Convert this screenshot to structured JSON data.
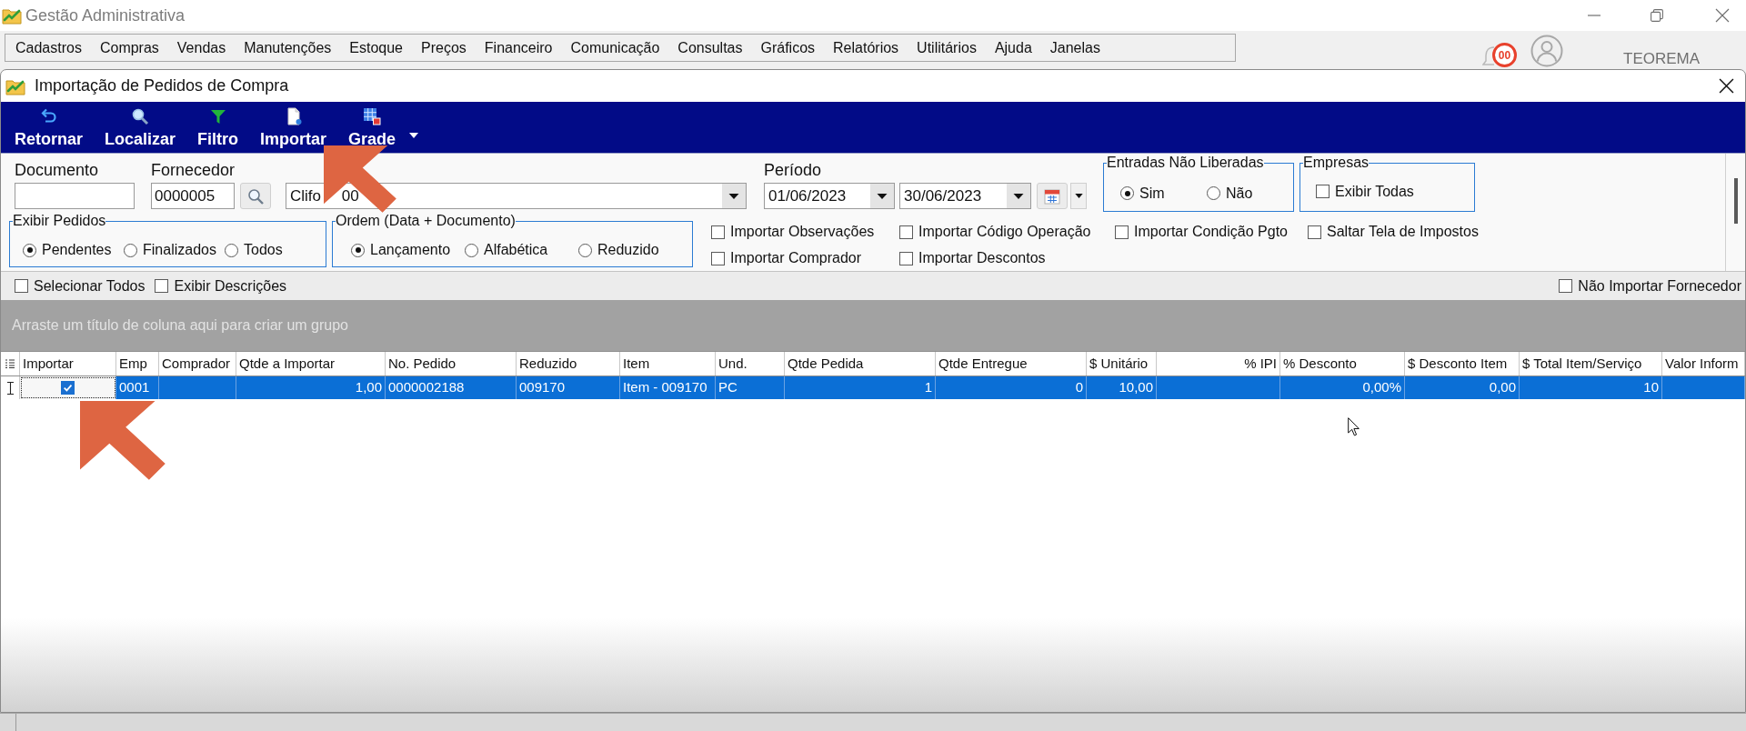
{
  "app": {
    "title": "Gestão Administrativa"
  },
  "menu": [
    "Cadastros",
    "Compras",
    "Vendas",
    "Manutenções",
    "Estoque",
    "Preços",
    "Financeiro",
    "Comunicação",
    "Consultas",
    "Gráficos",
    "Relatórios",
    "Utilitários",
    "Ajuda",
    "Janelas"
  ],
  "header_extras": {
    "notification_count": "00",
    "brand": "TEOREMA"
  },
  "window": {
    "title": "Importação de Pedidos de Compra"
  },
  "toolbar": [
    "Retornar",
    "Localizar",
    "Filtro",
    "Importar",
    "Grade"
  ],
  "filters": {
    "document": {
      "label": "Documento"
    },
    "supplier": {
      "label": "Fornecedor",
      "code": "0000005",
      "name_visible": [
        "Clifo",
        "00"
      ]
    },
    "period": {
      "label": "Período",
      "from": "01/06/2023",
      "to": "30/06/2023"
    },
    "unreleased_entries": {
      "title": "Entradas Não Liberadas",
      "options": [
        {
          "label": "Sim",
          "selected": true
        },
        {
          "label": "Não",
          "selected": false
        }
      ]
    },
    "companies": {
      "title": "Empresas",
      "show_all": {
        "label": "Exibir Todas",
        "checked": false
      }
    },
    "show_orders": {
      "title": "Exibir Pedidos",
      "options": [
        {
          "label": "Pendentes",
          "selected": true
        },
        {
          "label": "Finalizados",
          "selected": false
        },
        {
          "label": "Todos",
          "selected": false
        }
      ]
    },
    "order_by": {
      "title": "Ordem (Data + Documento)",
      "options": [
        {
          "label": "Lançamento",
          "selected": true
        },
        {
          "label": "Alfabética",
          "selected": false
        },
        {
          "label": "Reduzido",
          "selected": false
        }
      ]
    },
    "import_options": [
      [
        {
          "label": "Importar Observações",
          "checked": false
        },
        {
          "label": "Importar Comprador",
          "checked": false
        }
      ],
      [
        {
          "label": "Importar Código Operação",
          "checked": false
        },
        {
          "label": "Importar Descontos",
          "checked": false
        }
      ],
      [
        {
          "label": "Importar Condição Pgto",
          "checked": false
        }
      ],
      [
        {
          "label": "Saltar Tela de Impostos",
          "checked": false
        }
      ]
    ]
  },
  "grid_options": {
    "left": [
      {
        "label": "Selecionar Todos",
        "checked": false
      },
      {
        "label": "Exibir Descrições",
        "checked": false
      }
    ],
    "right": [
      {
        "label": "Não Importar Fornecedor",
        "checked": false
      }
    ]
  },
  "group_panel": {
    "hint": "Arraste um título de coluna aqui para criar um grupo"
  },
  "table": {
    "columns": [
      {
        "label": "Importar",
        "kind": "check"
      },
      {
        "label": "Emp",
        "kind": "text"
      },
      {
        "label": "Comprador",
        "kind": "text"
      },
      {
        "label": "Qtde a Importar",
        "kind": "number"
      },
      {
        "label": "No. Pedido",
        "kind": "text"
      },
      {
        "label": "Reduzido",
        "kind": "text"
      },
      {
        "label": "Item",
        "kind": "text"
      },
      {
        "label": "Und.",
        "kind": "text"
      },
      {
        "label": "Qtde Pedida",
        "kind": "number"
      },
      {
        "label": "Qtde Entregue",
        "kind": "number"
      },
      {
        "label": "$ Unitário",
        "kind": "number"
      },
      {
        "label": "% IPI",
        "kind": "number"
      },
      {
        "label": "% Desconto",
        "kind": "number"
      },
      {
        "label": "$ Desconto Item",
        "kind": "number"
      },
      {
        "label": "$ Total Item/Serviço",
        "kind": "number"
      },
      {
        "label": "Valor Inform",
        "kind": "number"
      }
    ],
    "rows": [
      {
        "selected": true,
        "cells": [
          {
            "checked": true,
            "focused": true
          },
          "0001",
          null,
          "1,00",
          "0000002188",
          "009170",
          "Item - 009170",
          "PC",
          "1",
          "0",
          "10,00",
          null,
          "0,00%",
          "0,00",
          "10",
          null
        ]
      }
    ]
  }
}
